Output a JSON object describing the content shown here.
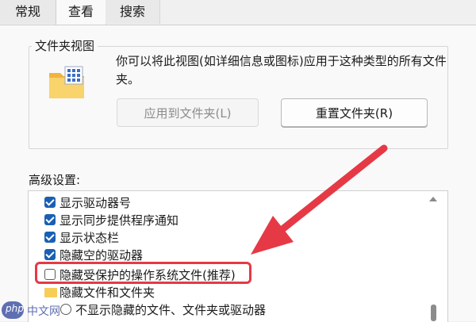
{
  "tabs": [
    {
      "label": "常规"
    },
    {
      "label": "查看"
    },
    {
      "label": "搜索"
    }
  ],
  "folder_views": {
    "title": "文件夹视图",
    "description": "你可以将此视图(如详细信息或图标)应用于这种类型的所有文件夹。",
    "apply_label": "应用到文件夹(L)",
    "reset_label": "重置文件夹(R)"
  },
  "advanced": {
    "label": "高级设置:",
    "items": [
      {
        "label": "显示驱动器号",
        "checked": true
      },
      {
        "label": "显示同步提供程序通知",
        "checked": true
      },
      {
        "label": "显示状态栏",
        "checked": true
      },
      {
        "label": "隐藏空的驱动器",
        "checked": true
      },
      {
        "label": "隐藏受保护的操作系统文件(推荐)",
        "checked": false
      },
      {
        "label": "隐藏文件和文件夹",
        "type": "folder"
      },
      {
        "label": "不显示隐藏的文件、文件夹或驱动器",
        "type": "radio"
      }
    ]
  },
  "colors": {
    "accent": "#1a5fb4",
    "highlight": "#e63946"
  },
  "watermark": {
    "logo": "php",
    "text": "中文网"
  }
}
